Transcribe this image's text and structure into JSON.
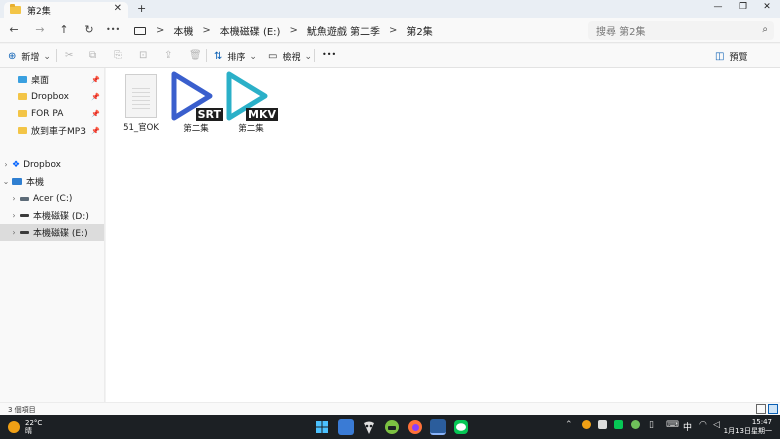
{
  "window": {
    "tab_title": "第2集",
    "tab_close": "✕",
    "new_tab": "+",
    "minimize": "—",
    "maximize": "❐",
    "close": "✕"
  },
  "nav": {
    "back": "←",
    "forward": "→",
    "up": "↑",
    "refresh": "↻",
    "more": "•••",
    "breadcrumb": [
      "本機",
      "本機磁碟 (E:)",
      "魷魚遊戲 第二季",
      "第2集"
    ],
    "separator": ">",
    "search_placeholder": "搜尋 第2集",
    "search_icon": "⌕"
  },
  "commands": {
    "new_label": "新增",
    "new_icon": "⊕",
    "sort_label": "排序",
    "sort_icon": "⇅",
    "view_label": "檢視",
    "view_icon": "▭",
    "more": "•••",
    "preview_label": "預覽",
    "preview_icon": "◫",
    "dropdown": "⌄",
    "cut_icon": "✂",
    "copy_icon": "⧉",
    "paste_icon": "⎘",
    "rename_icon": "⊡",
    "share_icon": "⇪",
    "delete_icon": "🗑"
  },
  "sidebar": {
    "quick_access": [
      {
        "label": "桌面",
        "icon": "desktop-icon",
        "color": "#3aa0e0"
      },
      {
        "label": "Dropbox",
        "icon": "folder-icon",
        "color": "#f3c547"
      },
      {
        "label": "FOR PA",
        "icon": "folder-icon",
        "color": "#f3c547"
      },
      {
        "label": "放到車子MP3",
        "icon": "folder-icon",
        "color": "#f3c547"
      }
    ],
    "pin": "📌",
    "tree": [
      {
        "label": "Dropbox",
        "chevron": "›"
      },
      {
        "label": "本機",
        "chevron": "⌄"
      },
      {
        "label": "Acer (C:)",
        "chevron": "›"
      },
      {
        "label": "本機磁碟 (D:)",
        "chevron": "›"
      },
      {
        "label": "本機磁碟 (E:)",
        "chevron": "›"
      }
    ]
  },
  "files": [
    {
      "name": "51_官OK",
      "type": "text-document"
    },
    {
      "name": "第二集",
      "type": "media",
      "ext": "SRT",
      "color": "#3a5fcd"
    },
    {
      "name": "第二集",
      "type": "media",
      "ext": "MKV",
      "color": "#2bb0c8"
    }
  ],
  "status": {
    "item_count": "3 個項目"
  },
  "taskbar": {
    "temperature": "22°C",
    "condition": "晴",
    "lang": "中",
    "time": "15:47",
    "date": "1月13日星期一",
    "apps": [
      {
        "name": "windows-start-icon",
        "color": "#1e90ff"
      },
      {
        "name": "calendar-app-icon",
        "color": "#3a7bd5"
      },
      {
        "name": "alien-app-icon",
        "color": "#cfcfcf"
      },
      {
        "name": "android-app-icon",
        "color": "#7cc142"
      },
      {
        "name": "firefox-icon",
        "color": "#ff7139"
      },
      {
        "name": "file-explorer-icon",
        "color": "#3a7bd5"
      },
      {
        "name": "line-app-icon",
        "color": "#06c755"
      }
    ]
  }
}
